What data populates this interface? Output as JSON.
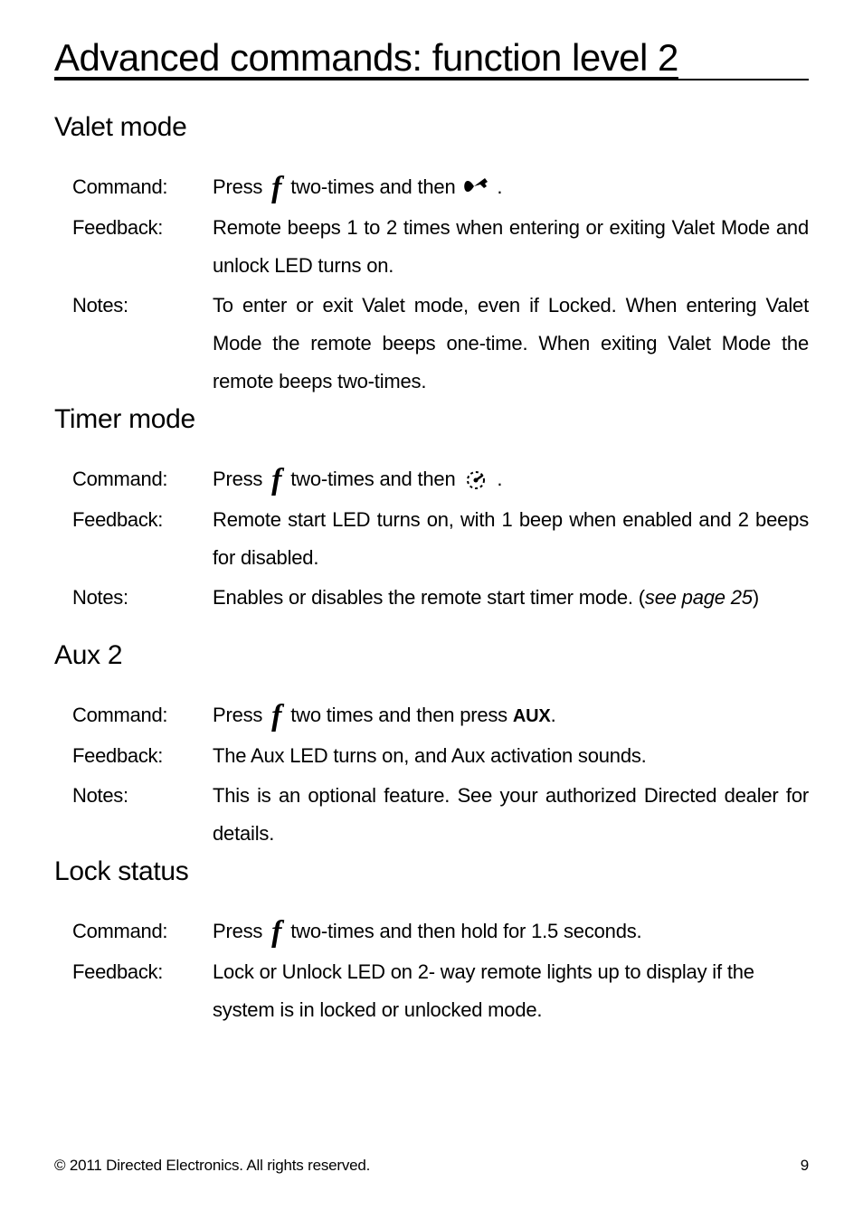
{
  "page": {
    "title": "Advanced commands: function level 2",
    "footer_left": "© 2011 Directed Electronics. All rights reserved.",
    "footer_right": "9"
  },
  "labels": {
    "command": "Command:",
    "feedback": "Feedback:",
    "notes": "Notes:"
  },
  "tokens": {
    "press": "Press",
    "f": "f",
    "two_times_then": "two-times and then",
    "two_times_then_press": "two times and then press",
    "two_times_then_hold": "two-times and then hold for 1.5 seconds.",
    "aux": "AUX"
  },
  "sections": [
    {
      "heading": "Valet mode",
      "command_tail": ".",
      "feedback": "Remote beeps 1 to 2 times when entering or exiting Valet Mode and unlock LED turns on.",
      "notes": "To enter or exit Valet mode, even if Locked. When entering Valet Mode the remote beeps one-time. When exiting Valet Mode the remote beeps two-times."
    },
    {
      "heading": "Timer mode",
      "command_tail": ".",
      "feedback": "Remote start LED turns on, with 1 beep when enabled and 2 beeps for disabled.",
      "notes_prefix": "Enables or disables the remote start timer mode. (",
      "notes_italic": "see page 25",
      "notes_suffix": ")"
    },
    {
      "heading": "Aux 2",
      "feedback": "The Aux LED turns on, and Aux activation sounds.",
      "notes": "This is an optional feature. See your authorized Directed dealer for details."
    },
    {
      "heading": "Lock status",
      "feedback": "Lock or Unlock LED on 2- way remote lights up to display if the system is in locked or unlocked mode."
    }
  ]
}
